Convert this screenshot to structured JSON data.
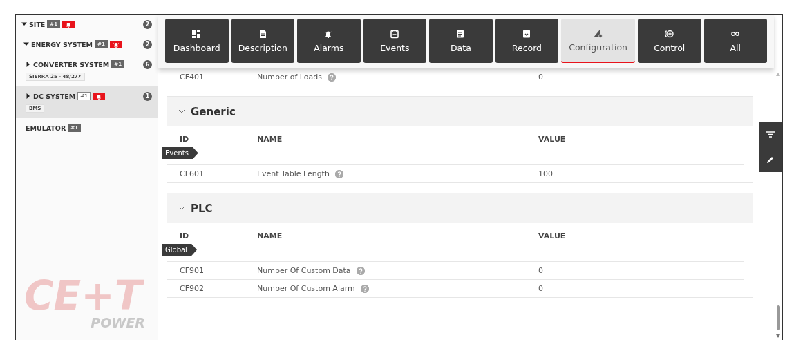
{
  "sidebar": {
    "items": [
      {
        "label": "SITE",
        "expandable": true,
        "expanded": true,
        "tag": "#1",
        "alarm": true,
        "count": "2",
        "selected": false,
        "children": [
          {
            "label": "ENERGY SYSTEM",
            "expandable": true,
            "expanded": true,
            "tag": "#1",
            "alarm": true,
            "count": "2",
            "selected": false,
            "children": [
              {
                "label": "CONVERTER SYSTEM",
                "expandable": true,
                "expanded": false,
                "tag": "#1",
                "alarm": false,
                "count": "6",
                "subtitle": "SIERRA 25 - 48/277",
                "selected": false
              },
              {
                "label": "DC SYSTEM",
                "expandable": true,
                "expanded": false,
                "tag": "#1",
                "alarm": true,
                "count": "1",
                "subtitle": "BMS",
                "selected": true
              },
              {
                "label": "EMULATOR",
                "expandable": false,
                "tag": "#1",
                "alarm": false,
                "selected": false
              }
            ]
          }
        ]
      }
    ]
  },
  "logo": {
    "mark": "CE+T",
    "sub": "POWER"
  },
  "tabs": [
    {
      "label": "Dashboard",
      "kind": "dashboard",
      "selected": false
    },
    {
      "label": "Description",
      "kind": "description",
      "selected": false
    },
    {
      "label": "Alarms",
      "kind": "alarms",
      "selected": false
    },
    {
      "label": "Events",
      "kind": "events",
      "selected": false
    },
    {
      "label": "Data",
      "kind": "data",
      "selected": false
    },
    {
      "label": "Record",
      "kind": "record",
      "selected": false
    },
    {
      "label": "Configuration",
      "kind": "configuration",
      "selected": true
    },
    {
      "label": "Control",
      "kind": "control",
      "selected": false
    },
    {
      "label": "All",
      "kind": "all",
      "selected": false
    }
  ],
  "scrolled_rows": [
    {
      "id": "CF401",
      "name": "Number of Loads",
      "value": "0"
    }
  ],
  "sections": [
    {
      "title": "Generic",
      "expanded": true,
      "tag": "Events",
      "columns": [
        "ID",
        "NAME",
        "VALUE"
      ],
      "rows": [
        {
          "id": "CF601",
          "name": "Event Table Length",
          "value": "100"
        }
      ]
    },
    {
      "title": "PLC",
      "expanded": true,
      "tag": "Global",
      "columns": [
        "ID",
        "NAME",
        "VALUE"
      ],
      "rows": [
        {
          "id": "CF901",
          "name": "Number Of Custom Data",
          "value": "0"
        },
        {
          "id": "CF902",
          "name": "Number Of Custom Alarm",
          "value": "0"
        }
      ]
    }
  ]
}
